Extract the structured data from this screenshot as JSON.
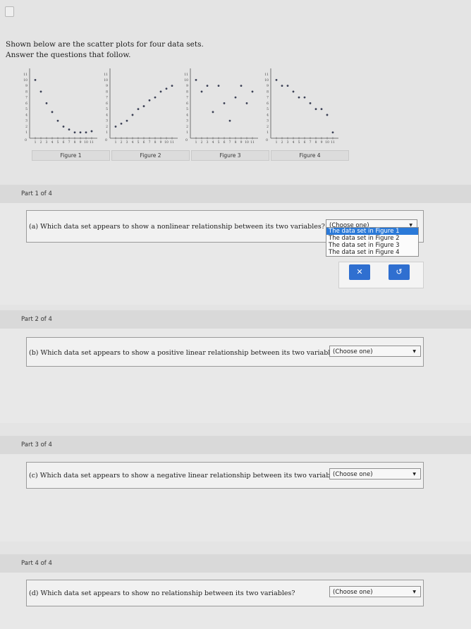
{
  "intro": {
    "line1": "Shown below are the scatter plots for four data sets.",
    "line2": "Answer the questions that follow."
  },
  "figures": [
    {
      "label": "Figure 1",
      "points": [
        [
          1,
          10
        ],
        [
          2,
          8
        ],
        [
          3,
          6
        ],
        [
          4,
          4.5
        ],
        [
          5,
          3
        ],
        [
          6,
          2
        ],
        [
          7,
          1.5
        ],
        [
          8,
          1
        ],
        [
          9,
          1
        ],
        [
          10,
          1
        ],
        [
          11,
          1.2
        ]
      ]
    },
    {
      "label": "Figure 2",
      "points": [
        [
          1,
          2
        ],
        [
          2,
          2.5
        ],
        [
          3,
          3
        ],
        [
          4,
          4
        ],
        [
          5,
          5
        ],
        [
          6,
          5.5
        ],
        [
          7,
          6.5
        ],
        [
          8,
          7
        ],
        [
          9,
          8
        ],
        [
          10,
          8.5
        ],
        [
          11,
          9
        ]
      ]
    },
    {
      "label": "Figure 3",
      "points": [
        [
          1,
          10
        ],
        [
          2,
          8
        ],
        [
          3,
          9
        ],
        [
          4,
          4.5
        ],
        [
          5,
          9
        ],
        [
          6,
          6
        ],
        [
          7,
          3
        ],
        [
          8,
          7
        ],
        [
          9,
          9
        ],
        [
          10,
          6
        ],
        [
          11,
          8
        ]
      ]
    },
    {
      "label": "Figure 4",
      "points": [
        [
          1,
          10
        ],
        [
          2,
          9
        ],
        [
          3,
          9
        ],
        [
          4,
          8
        ],
        [
          5,
          7
        ],
        [
          6,
          7
        ],
        [
          7,
          6
        ],
        [
          8,
          5
        ],
        [
          9,
          5
        ],
        [
          10,
          4
        ],
        [
          11,
          1
        ]
      ]
    }
  ],
  "axis": {
    "y_top": "11",
    "y_ticks": [
      "10",
      "9",
      "8",
      "7",
      "6",
      "5",
      "4",
      "3",
      "2",
      "1"
    ],
    "x_ticks": [
      "1",
      "2",
      "3",
      "4",
      "5",
      "6",
      "7",
      "8",
      "9",
      "10",
      "11"
    ],
    "zero": "0"
  },
  "parts": [
    {
      "header": "Part 1 of 4",
      "question": "(a)  Which data set appears to show a nonlinear relationship between its two variables?",
      "select": "(Choose one)"
    },
    {
      "header": "Part 2 of 4",
      "question": "(b)  Which data set appears to show a positive linear relationship between its two variables?",
      "select": "(Choose one)"
    },
    {
      "header": "Part 3 of 4",
      "question": "(c)  Which data set appears to show a negative linear relationship between its two variables?",
      "select": "(Choose one)"
    },
    {
      "header": "Part 4 of 4",
      "question": "(d)  Which data set appears to show no relationship between its two variables?",
      "select": "(Choose one)"
    }
  ],
  "dropdown_options": [
    "The data set in Figure 1",
    "The data set in Figure 2",
    "The data set in Figure 3",
    "The data set in Figure 4"
  ],
  "buttons": {
    "clear": "✕",
    "undo": "↺"
  },
  "colors": {
    "dot": "#3a3f54",
    "highlight": "#2a79d8",
    "button": "#2f6fd0"
  }
}
